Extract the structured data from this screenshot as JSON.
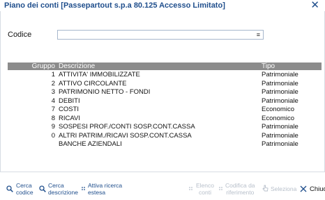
{
  "window": {
    "title": "Piano dei conti [Passepartout s.p.a 80.125 Accesso Limitato]",
    "close_glyph": "✕"
  },
  "form": {
    "codice_label": "Codice",
    "codice_value": "",
    "menu_glyph": "≡"
  },
  "table": {
    "headers": {
      "gruppo": "Gruppo",
      "descrizione": "Descrizione",
      "tipo": "Tipo"
    },
    "rows": [
      {
        "gruppo": "1",
        "descrizione": "ATTIVITA' IMMOBILIZZATE",
        "tipo": "Patrimoniale"
      },
      {
        "gruppo": "2",
        "descrizione": "ATTIVO CIRCOLANTE",
        "tipo": "Patrimoniale"
      },
      {
        "gruppo": "3",
        "descrizione": "PATRIMONIO NETTO - FONDI",
        "tipo": "Patrimoniale"
      },
      {
        "gruppo": "4",
        "descrizione": "DEBITI",
        "tipo": "Patrimoniale"
      },
      {
        "gruppo": "7",
        "descrizione": "COSTI",
        "tipo": "Economico"
      },
      {
        "gruppo": "8",
        "descrizione": "RICAVI",
        "tipo": "Economico"
      },
      {
        "gruppo": "9",
        "descrizione": "SOSPESI PROF./CONTI SOSP.CONT.CASSA",
        "tipo": "Patrimoniale"
      },
      {
        "gruppo": "0",
        "descrizione": "ALTRI PATRIM./RICAVI SOSP.CONT.CASSA",
        "tipo": "Patrimoniale"
      },
      {
        "gruppo": "",
        "descrizione": "BANCHE AZIENDALI",
        "tipo": "Patrimoniale"
      }
    ]
  },
  "toolbar": {
    "cerca_codice": "Cerca\ncodice",
    "cerca_descrizione": "Cerca\ndescrizione",
    "attiva_ricerca": "Attiva ricerca\nestesa",
    "elenco_conti": "Elenco\nconti",
    "codifica_riferimento": "Codifica da\nriferimento",
    "seleziona": "Seleziona",
    "chiudi": "Chiud"
  },
  "colors": {
    "title": "#1f4e8c",
    "header_bg": "#8c8c8c",
    "disabled": "#b7bfca"
  },
  "icons": {
    "cerca_codice": "magnifier-icon",
    "cerca_descrizione": "magnifier-icon",
    "attiva_ricerca": "dots-icon",
    "elenco_conti": "dots-icon",
    "codifica_riferimento": "dots-icon",
    "seleziona": "pointer-icon",
    "chiudi": "close-icon"
  }
}
